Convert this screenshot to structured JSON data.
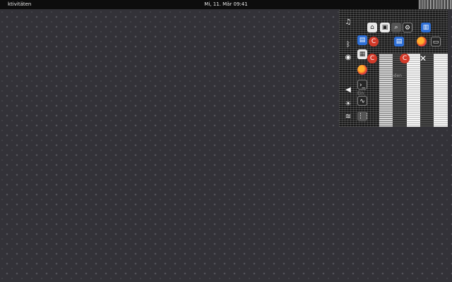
{
  "topbar": {
    "activities_label": "ktivitäten",
    "clock": "Mi, 11. Mär  09:41"
  },
  "popup": {
    "ghost_text_1": "oden",
    "ghost_text_2": "Ein"
  },
  "icons": {
    "system_column": [
      "microphone-icon",
      "bluetooth-icon",
      "wifi-icon",
      "brightness-icon",
      "volume-icon",
      "network-icon",
      "settings-icon"
    ],
    "apps": [
      "files-icon",
      "firefox-icon",
      "terminal-icon",
      "system-monitor-icon",
      "app-grid-icon",
      "software-icon"
    ]
  },
  "colors": {
    "topbar_bg": "#0d0d0d",
    "desktop_bg": "#333238",
    "accent_blue": "#2e6fd6",
    "accent_red": "#d23a2a"
  }
}
